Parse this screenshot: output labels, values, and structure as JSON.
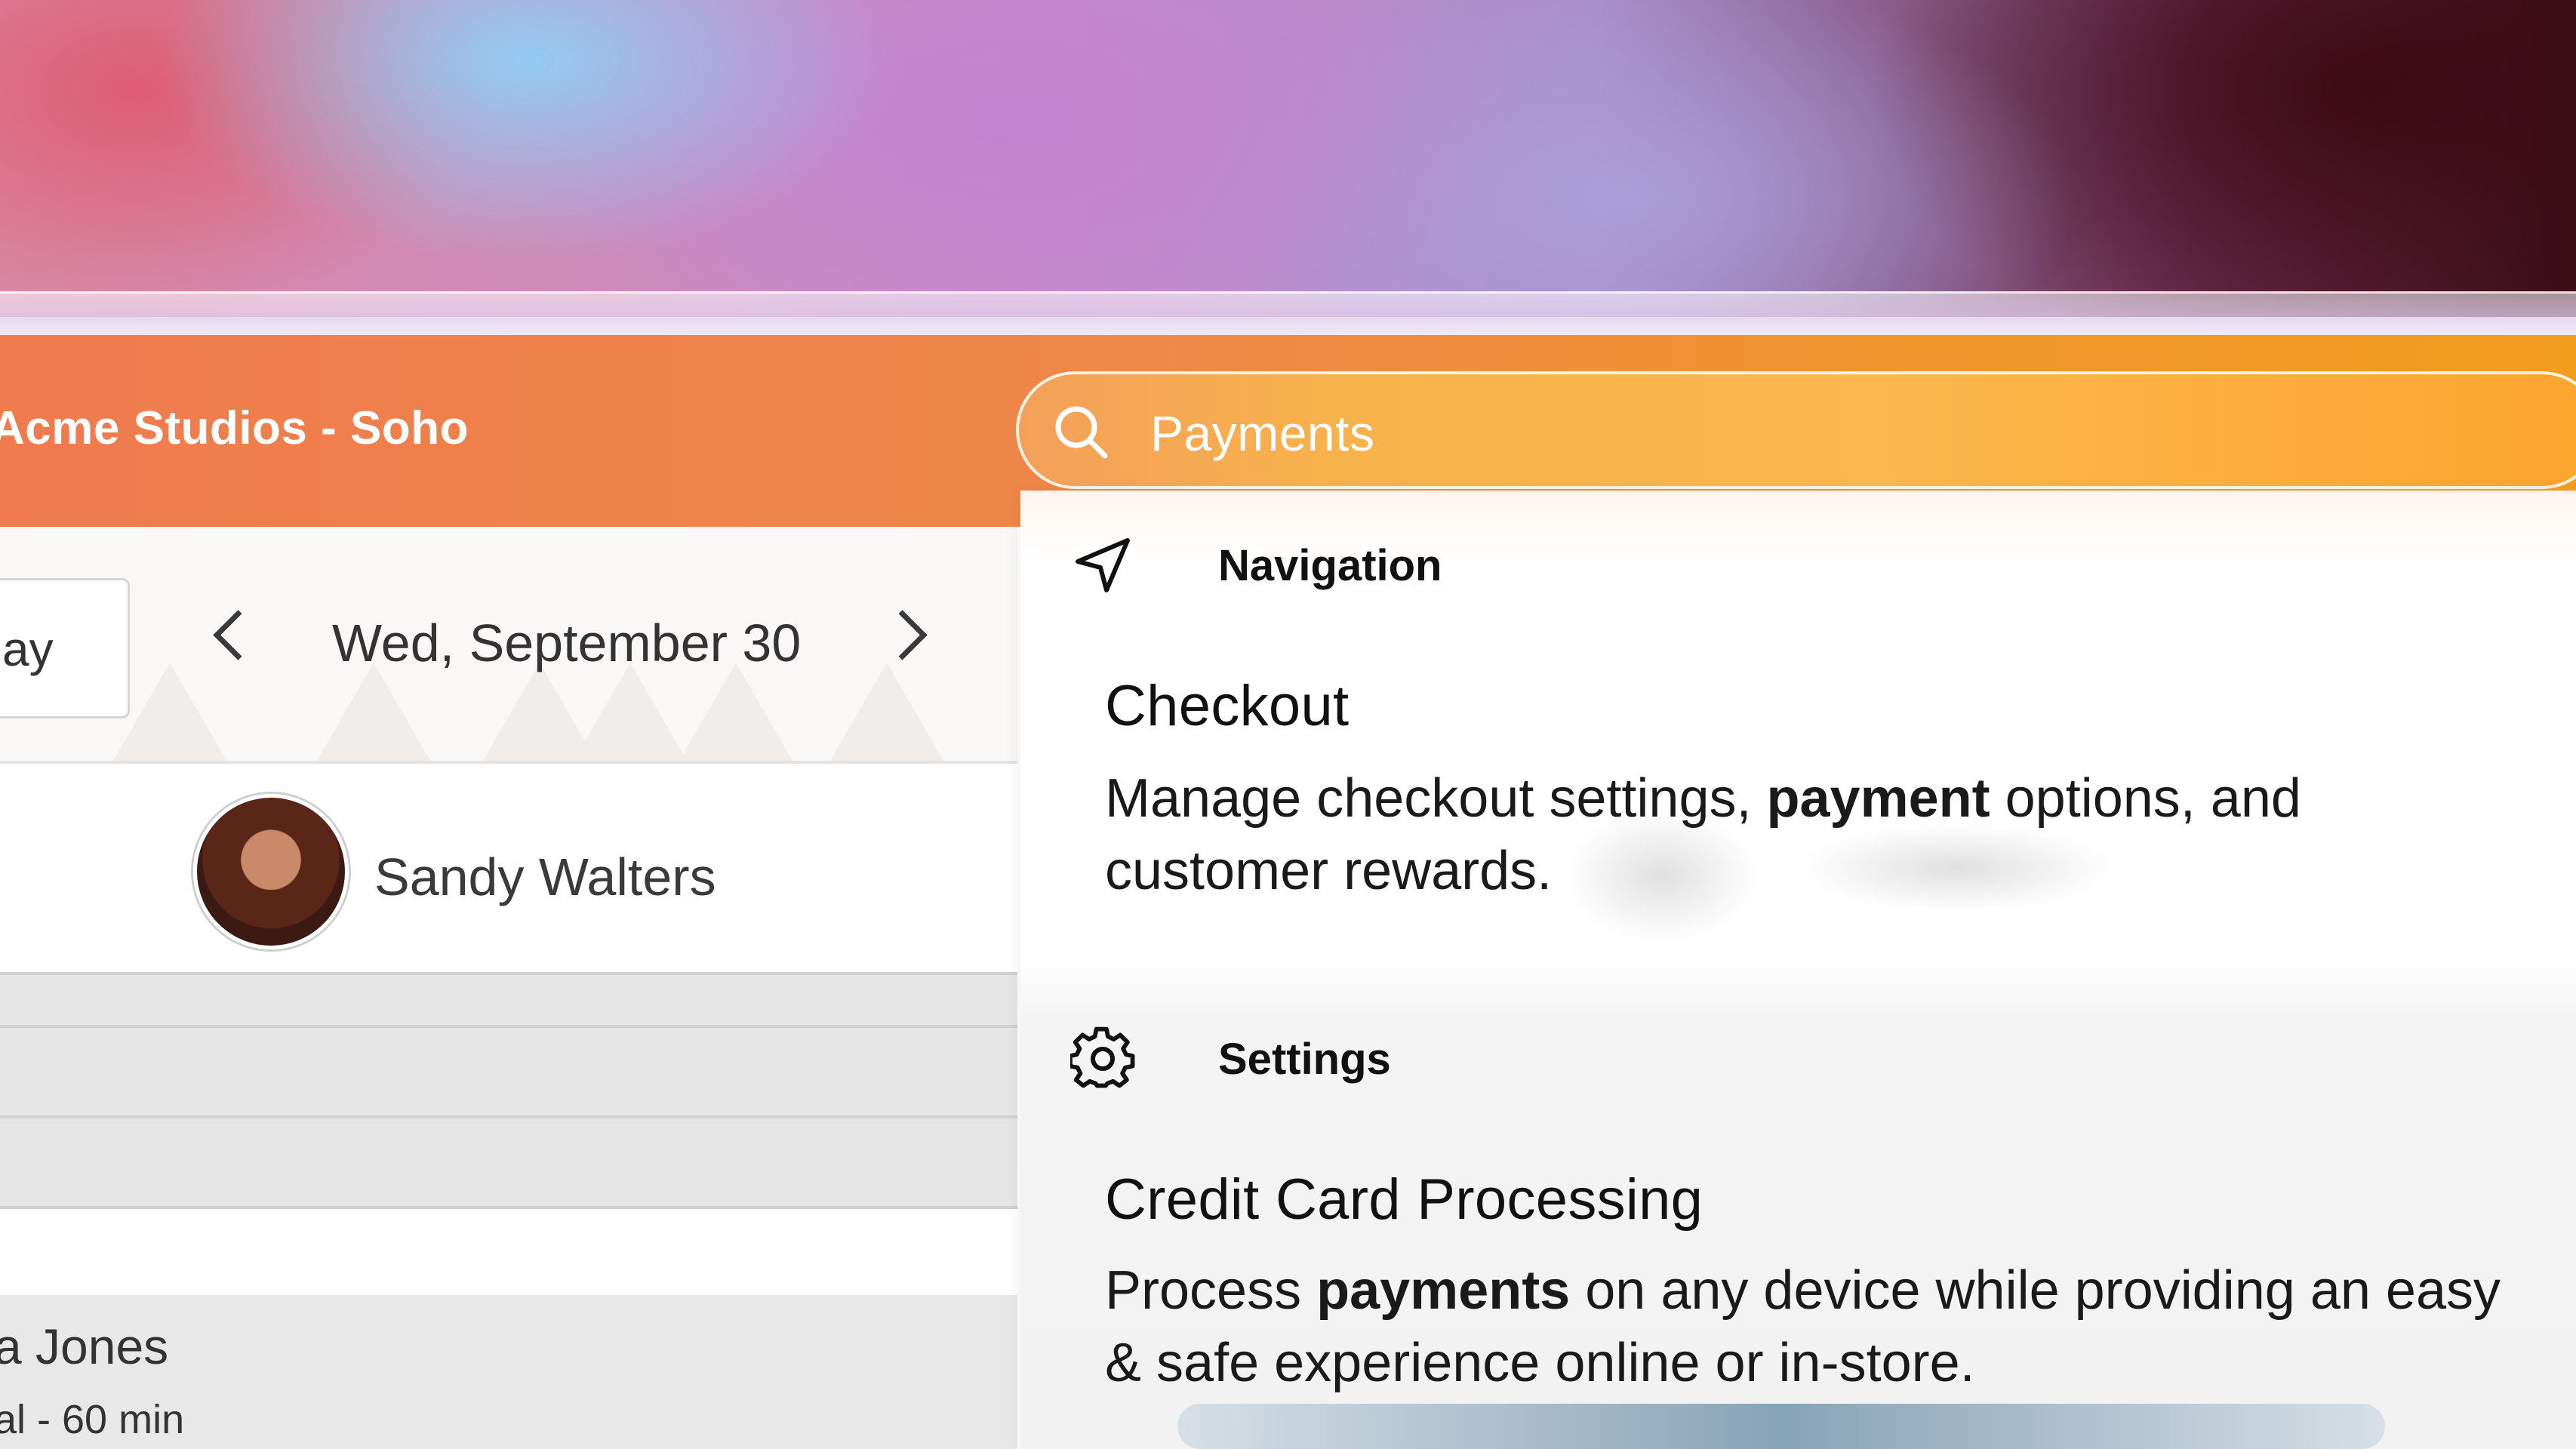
{
  "header": {
    "studio_name": "Acme Studios - Soho"
  },
  "search": {
    "query": "Payments",
    "icon": "search-icon"
  },
  "calendar": {
    "today_label": "ay",
    "date_label": "Wed, September 30",
    "prev_icon": "chevron-left-icon",
    "next_icon": "chevron-right-icon"
  },
  "staff": {
    "name": "Sandy Walters"
  },
  "appointment": {
    "client_name": "a Jones",
    "detail": "al - 60 min"
  },
  "results": {
    "sections": [
      {
        "heading": "Navigation",
        "icon": "navigation-arrow-icon",
        "item": {
          "title": "Checkout",
          "desc_before": "Manage checkout settings, ",
          "desc_bold": "payment",
          "desc_after": " options, and customer rewards."
        }
      },
      {
        "heading": "Settings",
        "icon": "gear-icon",
        "item": {
          "title": "Credit Card Processing",
          "desc_before": "Process ",
          "desc_bold": "payments",
          "desc_after": " on any device while providing an easy & safe experience online or in-store."
        }
      }
    ]
  },
  "colors": {
    "header_orange": "#ef7b4e",
    "search_orange": "#fcb74d"
  }
}
